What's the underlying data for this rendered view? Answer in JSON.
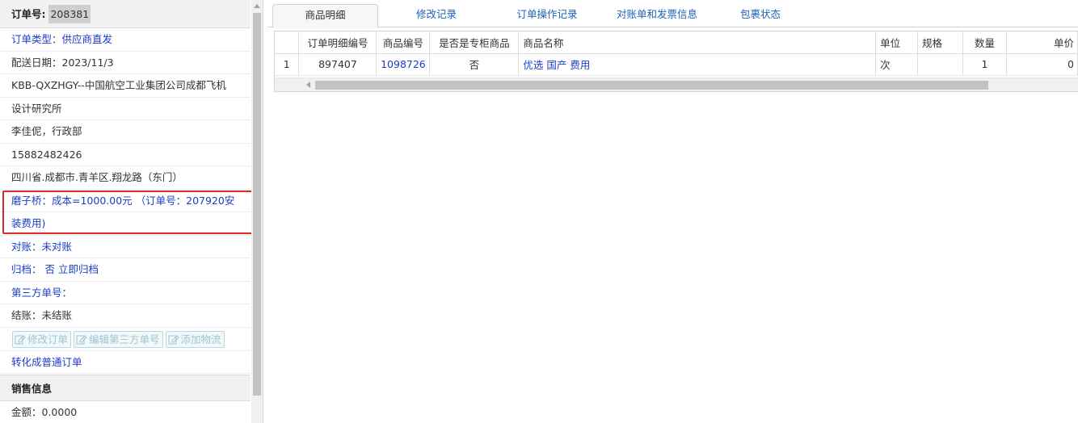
{
  "order": {
    "label": "订单号:",
    "number": "208381",
    "type": "订单类型：供应商直发",
    "delivery_date": "配送日期：2023/11/3",
    "customer_line1": "KBB-QXZHGY--中国航空工业集团公司成都飞机",
    "customer_line2": "设计研究所",
    "contact": "李佳伲，行政部",
    "phone": "15882482426",
    "address": "四川省.成都市.青羊区.翔龙路（东门）",
    "supplier_cost_line1": "磨子桥：成本=1000.00元 （订单号：207920安",
    "supplier_cost_line2": "装费用)",
    "reconcile": "对账：未对账",
    "archive": "归档： 否 立即归档",
    "third_party_no": "第三方单号：",
    "settlement": "结账：未结账",
    "convert_link": "转化成普通订单"
  },
  "buttons": {
    "edit_order": "修改订单",
    "edit_third_party": "编辑第三方单号",
    "add_logistics": "添加物流"
  },
  "sales": {
    "title": "销售信息",
    "amount": "金额：0.0000"
  },
  "tabs": [
    {
      "label": "商品明细",
      "active": true
    },
    {
      "label": "修改记录"
    },
    {
      "label": "订单操作记录"
    },
    {
      "label": "对账单和发票信息"
    },
    {
      "label": "包裹状态"
    }
  ],
  "grid": {
    "columns": [
      "",
      "订单明细编号",
      "商品编号",
      "是否是专柜商品",
      "商品名称",
      "单位",
      "规格",
      "数量",
      "单价"
    ],
    "rows": [
      {
        "index": "1",
        "detail_no": "897407",
        "product_no": "1098726",
        "counter": "否",
        "name": "优选 国产 费用",
        "unit": "次",
        "spec": "",
        "qty": "1",
        "price": "0"
      }
    ]
  },
  "colors": {
    "link": "#1a3ec7",
    "tab_link": "#1c62b9",
    "highlight": "#e02828"
  }
}
